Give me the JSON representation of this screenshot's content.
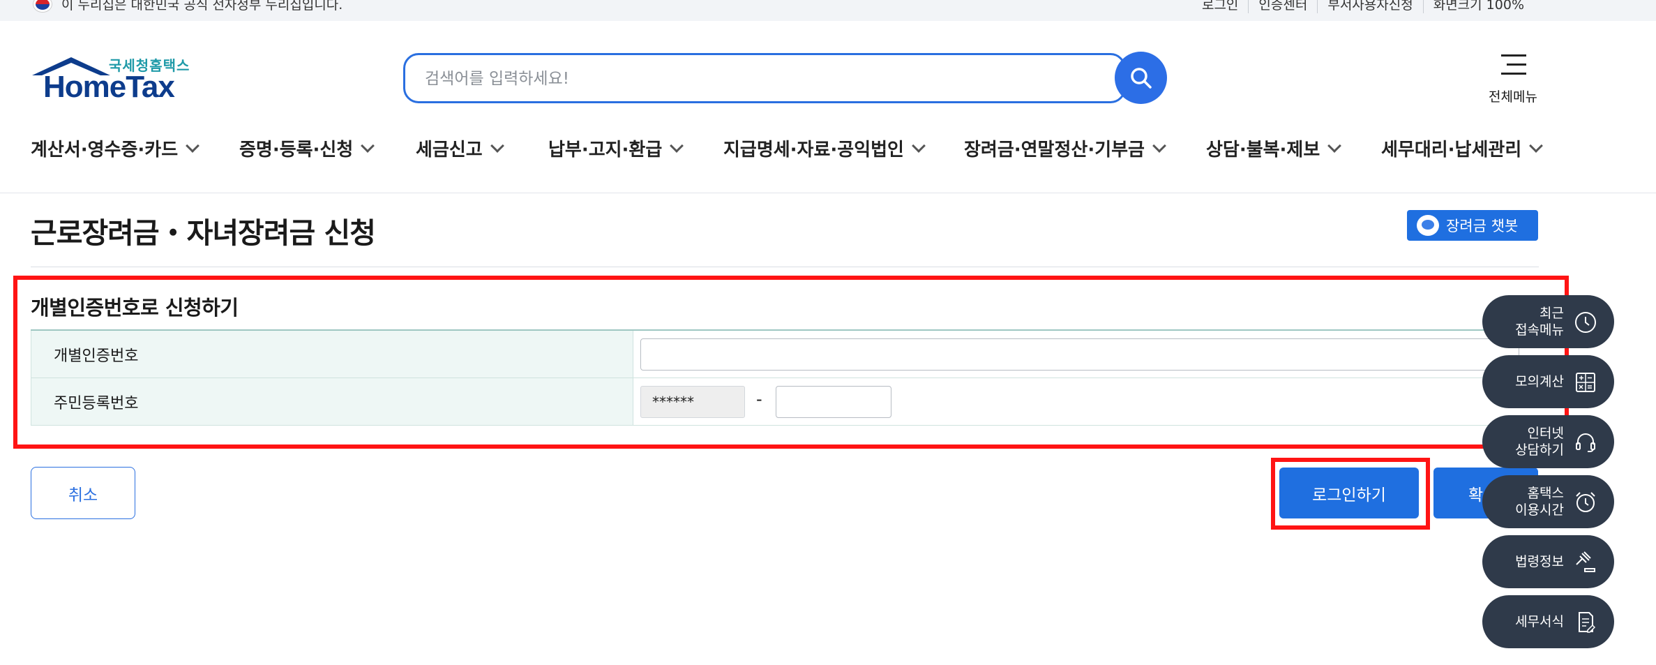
{
  "topbar": {
    "notice": "이 누리집은 대한민국 공식 전자정부 누리집입니다.",
    "links": [
      "로그인",
      "인증센터",
      "부서사용자신청",
      "화면크기 100%"
    ]
  },
  "header": {
    "logo_sub": "국세청홈택스",
    "logo_main": "HomeTax",
    "search_placeholder": "검색어를 입력하세요!",
    "all_menu_label": "전체메뉴"
  },
  "gnb": {
    "items": [
      "계산서·영수증·카드",
      "증명·등록·신청",
      "세금신고",
      "납부·고지·환급",
      "지급명세·자료·공익법인",
      "장려금·연말정산·기부금",
      "상담·불복·제보",
      "세무대리·납세관리"
    ]
  },
  "page": {
    "title": "근로장려금・자녀장려금 신청",
    "chatbot_label": "장려금 챗봇"
  },
  "form": {
    "section_title": "개별인증번호로 신청하기",
    "rows": [
      {
        "label": "개별인증번호",
        "value": ""
      },
      {
        "label": "주민등록번호",
        "masked": "******",
        "separator": "-",
        "value": ""
      }
    ]
  },
  "buttons": {
    "cancel": "취소",
    "login": "로그인하기",
    "confirm": "확"
  },
  "quick_menu": [
    {
      "line1": "최근",
      "line2": "접속메뉴",
      "icon": "clock-icon"
    },
    {
      "line1": "모의계산",
      "line2": "",
      "icon": "calculator-icon"
    },
    {
      "line1": "인터넷",
      "line2": "상담하기",
      "icon": "headset-icon"
    },
    {
      "line1": "홈택스",
      "line2": "이용시간",
      "icon": "alarm-icon"
    },
    {
      "line1": "법령정보",
      "line2": "",
      "icon": "gavel-icon"
    },
    {
      "line1": "세무서식",
      "line2": "",
      "icon": "document-icon"
    }
  ],
  "colors": {
    "primary": "#1f6fe0",
    "highlight": "#ff1414",
    "quick_menu_bg": "#2f3a4a",
    "table_header_bg": "#eef7f5"
  }
}
